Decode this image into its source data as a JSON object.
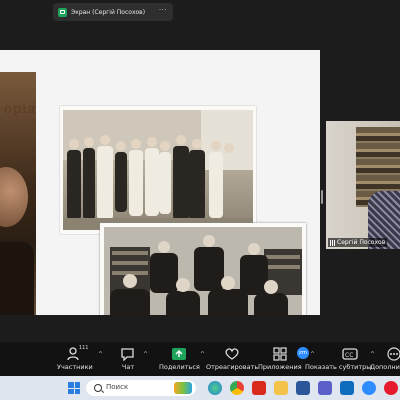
{
  "share_bar": {
    "title": "Экран (Сергій Посохов)",
    "more": "···",
    "indicator_color": "#1ea35b"
  },
  "slide": {
    "background": "#f4f4f4",
    "portrait_title": "орія"
  },
  "participant": {
    "name": "Сергій Посохов",
    "mic_icon": "mic-icon"
  },
  "toolbar": {
    "participants": {
      "label": "Участники",
      "count": "111",
      "icon": "participants-icon"
    },
    "chat": {
      "label": "Чат",
      "icon": "chat-icon"
    },
    "share": {
      "label": "Поделиться",
      "icon": "share-screen-icon",
      "color": "#1ea35b"
    },
    "react": {
      "label": "Отреагировать",
      "icon": "heart-icon"
    },
    "apps": {
      "label": "Приложения",
      "icon": "apps-icon"
    },
    "captions": {
      "label": "Показать субтитры",
      "icon": "cc-icon"
    },
    "more": {
      "label": "Дополнит",
      "icon": "more-icon"
    },
    "zoom_badge": "zm"
  },
  "taskbar": {
    "search_placeholder": "Поиск",
    "apps": [
      "edge-icon",
      "chrome-icon",
      "acrobat-icon",
      "file-explorer-icon",
      "word-icon",
      "teams-icon",
      "outlook-icon",
      "zoom-icon",
      "opera-icon"
    ]
  }
}
